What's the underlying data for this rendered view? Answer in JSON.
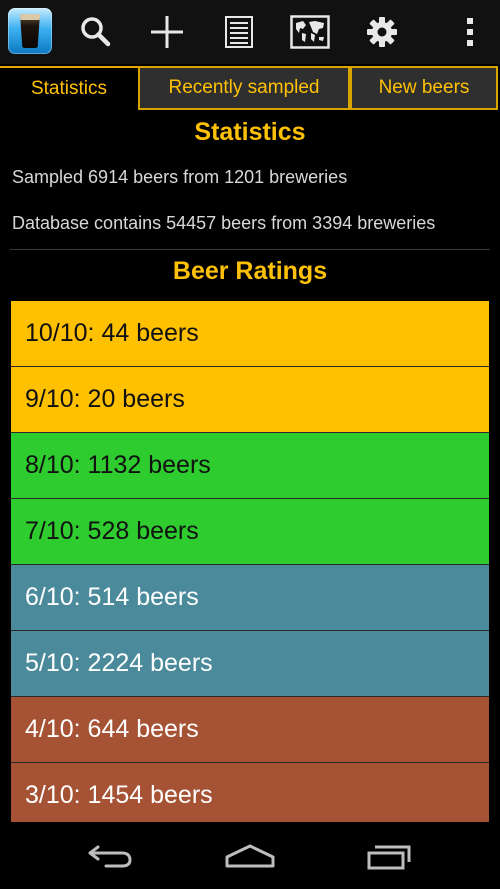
{
  "actionbar": {
    "icons": [
      "app-logo-icon",
      "search-icon",
      "add-icon",
      "list-icon",
      "world-map-icon",
      "gear-icon",
      "overflow-menu-icon"
    ]
  },
  "tabs": [
    {
      "label": "Statistics",
      "active": true
    },
    {
      "label": "Recently sampled",
      "active": false
    },
    {
      "label": "New beers",
      "active": false
    }
  ],
  "statistics": {
    "title": "Statistics",
    "sampled": "Sampled 6914 beers from 1201 breweries",
    "database": "Database contains 54457 beers from 3394 breweries"
  },
  "ratings": {
    "title": "Beer Ratings",
    "items": [
      {
        "label": "10/10: 44 beers",
        "color": "#ffc000",
        "text_color": "#111111"
      },
      {
        "label": "9/10: 20 beers",
        "color": "#ffc000",
        "text_color": "#111111"
      },
      {
        "label": "8/10: 1132 beers",
        "color": "#2ecc2e",
        "text_color": "#111111"
      },
      {
        "label": "7/10: 528 beers",
        "color": "#2ecc2e",
        "text_color": "#111111"
      },
      {
        "label": "6/10: 514 beers",
        "color": "#4a8a9a",
        "text_color": "#ffffff"
      },
      {
        "label": "5/10: 2224 beers",
        "color": "#4a8a9a",
        "text_color": "#ffffff"
      },
      {
        "label": "4/10: 644 beers",
        "color": "#a65234",
        "text_color": "#ffffff"
      },
      {
        "label": "3/10: 1454 beers",
        "color": "#a65234",
        "text_color": "#ffffff"
      }
    ]
  },
  "navbar": {
    "icons": [
      "back-icon",
      "home-icon",
      "recent-apps-icon"
    ]
  },
  "colors": {
    "accent": "#ffc107",
    "tab_border": "#d9a400"
  }
}
